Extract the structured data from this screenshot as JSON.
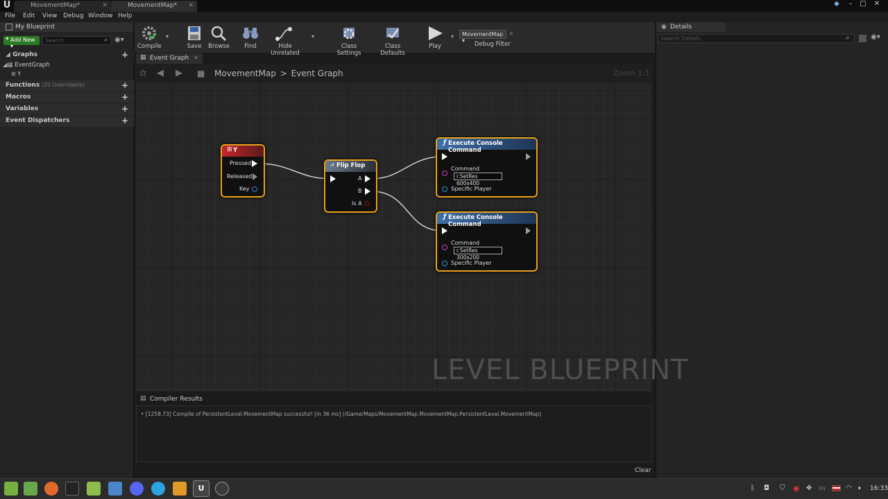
{
  "titlebar": {
    "tabs": [
      {
        "label": "MovementMap*"
      },
      {
        "label": "MovementMap*"
      }
    ]
  },
  "menu": [
    "File",
    "Edit",
    "View",
    "Debug",
    "Window",
    "Help"
  ],
  "left_panel": {
    "title": "My Blueprint",
    "add_new": "Add New",
    "search_placeholder": "Search",
    "graphs_label": "Graphs",
    "event_graph": "EventGraph",
    "event_graph_child": "Y",
    "functions_label": "Functions",
    "functions_note": "(20 Overridable)",
    "macros_label": "Macros",
    "variables_label": "Variables",
    "dispatchers_label": "Event Dispatchers"
  },
  "toolbar": {
    "compile": "Compile",
    "save": "Save",
    "browse": "Browse",
    "find": "Find",
    "hide_unrelated": "Hide Unrelated",
    "class_settings": "Class Settings",
    "class_defaults": "Class Defaults",
    "play": "Play",
    "debug_select": "MovementMap",
    "debug_filter": "Debug Filter"
  },
  "details": {
    "title": "Details",
    "search_placeholder": "Search Details"
  },
  "graph": {
    "tab_label": "Event Graph",
    "breadcrumb_root": "MovementMap",
    "breadcrumb_sep": ">",
    "breadcrumb_leaf": "Event Graph",
    "zoom": "Zoom 1:1",
    "watermark": "LEVEL BLUEPRINT",
    "nodes": {
      "key_event": {
        "title": "Y",
        "pins": [
          "Pressed",
          "Released",
          "Key"
        ]
      },
      "flip_flop": {
        "title": "Flip Flop",
        "pins": [
          "A",
          "B",
          "Is A"
        ]
      },
      "exec1": {
        "title": "Execute Console Command",
        "command_label": "Command",
        "command_value": "r.SetRes 600x400",
        "player_label": "Specific Player"
      },
      "exec2": {
        "title": "Execute Console Command",
        "command_label": "Command",
        "command_value": "r.SetRes 300x200",
        "player_label": "Specific Player"
      }
    }
  },
  "compiler": {
    "tab_label": "Compiler Results",
    "message": "[1258.73] Compile of PersistentLevel.MovementMap successful! [in 36 ms] (/Game/Maps/MovementMap.MovementMap:PersistentLevel.MovementMap)",
    "clear": "Clear"
  },
  "taskbar": {
    "locale": "EN",
    "clock": "16:33"
  }
}
